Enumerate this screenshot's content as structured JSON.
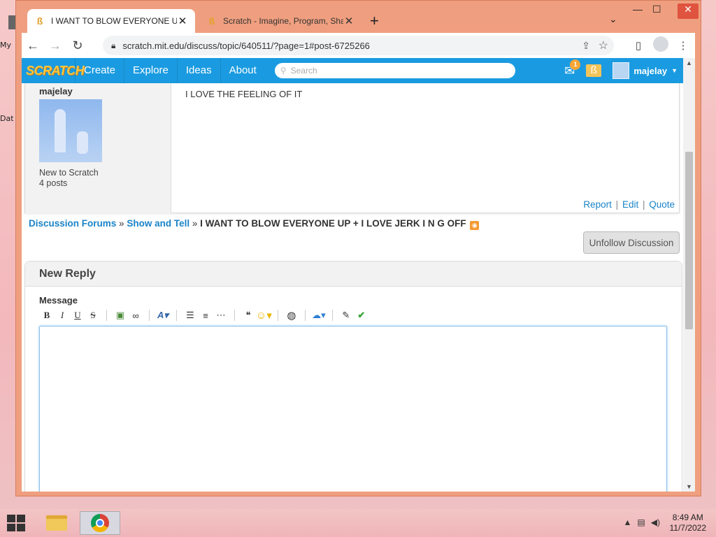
{
  "desktop": {
    "icon_a_label": "My",
    "icon_b_label": "Dat"
  },
  "browser": {
    "tabs": [
      {
        "title": "I WANT TO BLOW EVERYONE UP",
        "active": true
      },
      {
        "title": "Scratch - Imagine, Program, Shar",
        "active": false
      }
    ],
    "url": "scratch.mit.edu/discuss/topic/640511/?page=1#post-6725266"
  },
  "scratch_nav": {
    "logo": "SCRATCH",
    "links": [
      "Create",
      "Explore",
      "Ideas",
      "About"
    ],
    "search_placeholder": "Search",
    "message_count": "1",
    "username": "majelay"
  },
  "post": {
    "username": "majelay",
    "rank": "New to Scratch",
    "post_count": "4 posts",
    "body": "I LOVE THE FEELING OF IT",
    "actions": {
      "report": "Report",
      "edit": "Edit",
      "quote": "Quote"
    }
  },
  "breadcrumb": {
    "forums": "Discussion Forums",
    "sep": "»",
    "section": "Show and Tell",
    "topic": "I WANT TO BLOW EVERYONE UP + I LOVE JERK I N G OFF"
  },
  "unfollow_label": "Unfollow Discussion",
  "reply": {
    "heading": "New Reply",
    "message_label": "Message",
    "toolbar": {
      "bold": "B",
      "italic": "I",
      "underline": "U",
      "strike": "S"
    }
  },
  "taskbar": {
    "time": "8:49 AM",
    "date": "11/7/2022"
  },
  "colors": {
    "scratch_blue": "#1a9be1",
    "link_blue": "#1a83c7",
    "window_frame": "#ef9f7f"
  }
}
